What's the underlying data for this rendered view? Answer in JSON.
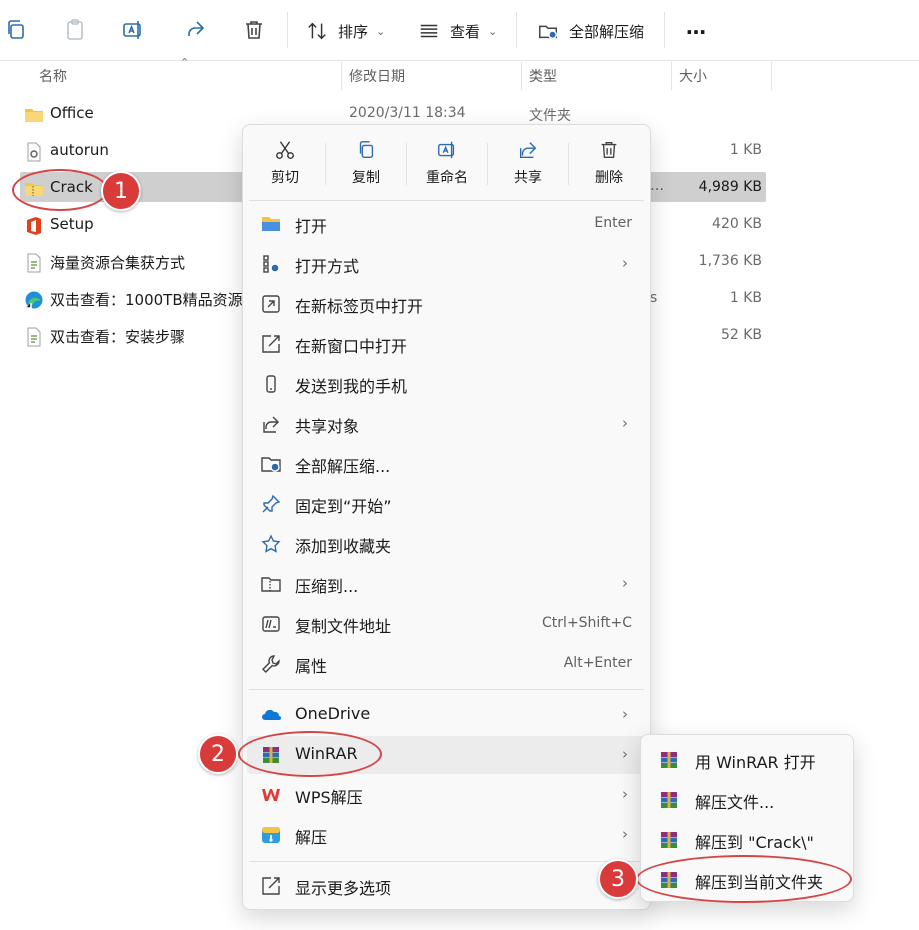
{
  "toolbar": {
    "sort_label": "排序",
    "view_label": "查看",
    "extract_all_label": "全部解压缩",
    "more_label": "…"
  },
  "columns": {
    "name": "名称",
    "date": "修改日期",
    "type": "类型",
    "size": "大小"
  },
  "files": [
    {
      "name": "Office",
      "date": "2020/3/11 18:34",
      "type": "文件夹",
      "size": "",
      "icon": "folder-icon"
    },
    {
      "name": "autorun",
      "date": "",
      "type": "",
      "size": "1 KB",
      "icon": "settings-file-icon"
    },
    {
      "name": "Crack",
      "date": "",
      "type": "",
      "size": "4,989 KB",
      "icon": "zip-folder-icon",
      "selected": true
    },
    {
      "name": "Setup",
      "date": "",
      "type": "",
      "size": "420 KB",
      "icon": "office-setup-icon"
    },
    {
      "name": "海量资源合集获方式",
      "date": "",
      "type": "",
      "size": "1,736 KB",
      "icon": "text-file-icon"
    },
    {
      "name": "双击查看：1000TB精品资源-",
      "date": "",
      "type": "",
      "size": "1 KB",
      "icon": "edge-shortcut-icon"
    },
    {
      "name": "双击查看：安装步骤",
      "date": "",
      "type": "",
      "size": "52 KB",
      "icon": "text-file-icon"
    }
  ],
  "selected_row_partial_text": "…",
  "edge_row_partial_text": "s",
  "quick_actions": [
    "剪切",
    "复制",
    "重命名",
    "共享",
    "删除"
  ],
  "menu_items": [
    {
      "label": "打开",
      "shortcut": "Enter",
      "submenu": false,
      "icon": "folder-open-icon"
    },
    {
      "label": "打开方式",
      "shortcut": "",
      "submenu": true,
      "icon": "open-with-icon"
    },
    {
      "label": "在新标签页中打开",
      "shortcut": "",
      "submenu": false,
      "icon": "new-tab-icon"
    },
    {
      "label": "在新窗口中打开",
      "shortcut": "",
      "submenu": false,
      "icon": "new-window-icon"
    },
    {
      "label": "发送到我的手机",
      "shortcut": "",
      "submenu": false,
      "icon": "phone-icon"
    },
    {
      "label": "共享对象",
      "shortcut": "",
      "submenu": true,
      "icon": "share-icon"
    },
    {
      "label": "全部解压缩...",
      "shortcut": "",
      "submenu": false,
      "icon": "extract-all-icon"
    },
    {
      "label": "固定到“开始”",
      "shortcut": "",
      "submenu": false,
      "icon": "pin-icon"
    },
    {
      "label": "添加到收藏夹",
      "shortcut": "",
      "submenu": false,
      "icon": "star-icon"
    },
    {
      "label": "压缩到...",
      "shortcut": "",
      "submenu": true,
      "icon": "compress-icon"
    },
    {
      "label": "复制文件地址",
      "shortcut": "Ctrl+Shift+C",
      "submenu": false,
      "icon": "copy-path-icon"
    },
    {
      "label": "属性",
      "shortcut": "Alt+Enter",
      "submenu": false,
      "icon": "wrench-icon"
    },
    {
      "label": "OneDrive",
      "shortcut": "",
      "submenu": true,
      "icon": "onedrive-icon"
    },
    {
      "label": "WinRAR",
      "shortcut": "",
      "submenu": true,
      "icon": "winrar-icon",
      "highlighted": true
    },
    {
      "label": "WPS解压",
      "shortcut": "",
      "submenu": true,
      "icon": "wps-icon"
    },
    {
      "label": "解压",
      "shortcut": "",
      "submenu": true,
      "icon": "unzip-app-icon"
    },
    {
      "label": "显示更多选项",
      "shortcut": "",
      "submenu": false,
      "icon": "more-options-icon"
    }
  ],
  "submenu_items": [
    {
      "label": "用 WinRAR 打开"
    },
    {
      "label": "解压文件..."
    },
    {
      "label": "解压到 \"Crack\\\""
    },
    {
      "label": "解压到当前文件夹"
    }
  ],
  "annotations": [
    "1",
    "2",
    "3"
  ],
  "colors": {
    "annotation_red": "#d93b3b",
    "selection_gray": "#cfcfcf",
    "menu_bg": "#f9f9f9",
    "folder_yellow": "#f4c542",
    "office_red": "#e2401b",
    "onedrive_blue": "#0f78d4",
    "wps_red": "#e53935"
  }
}
